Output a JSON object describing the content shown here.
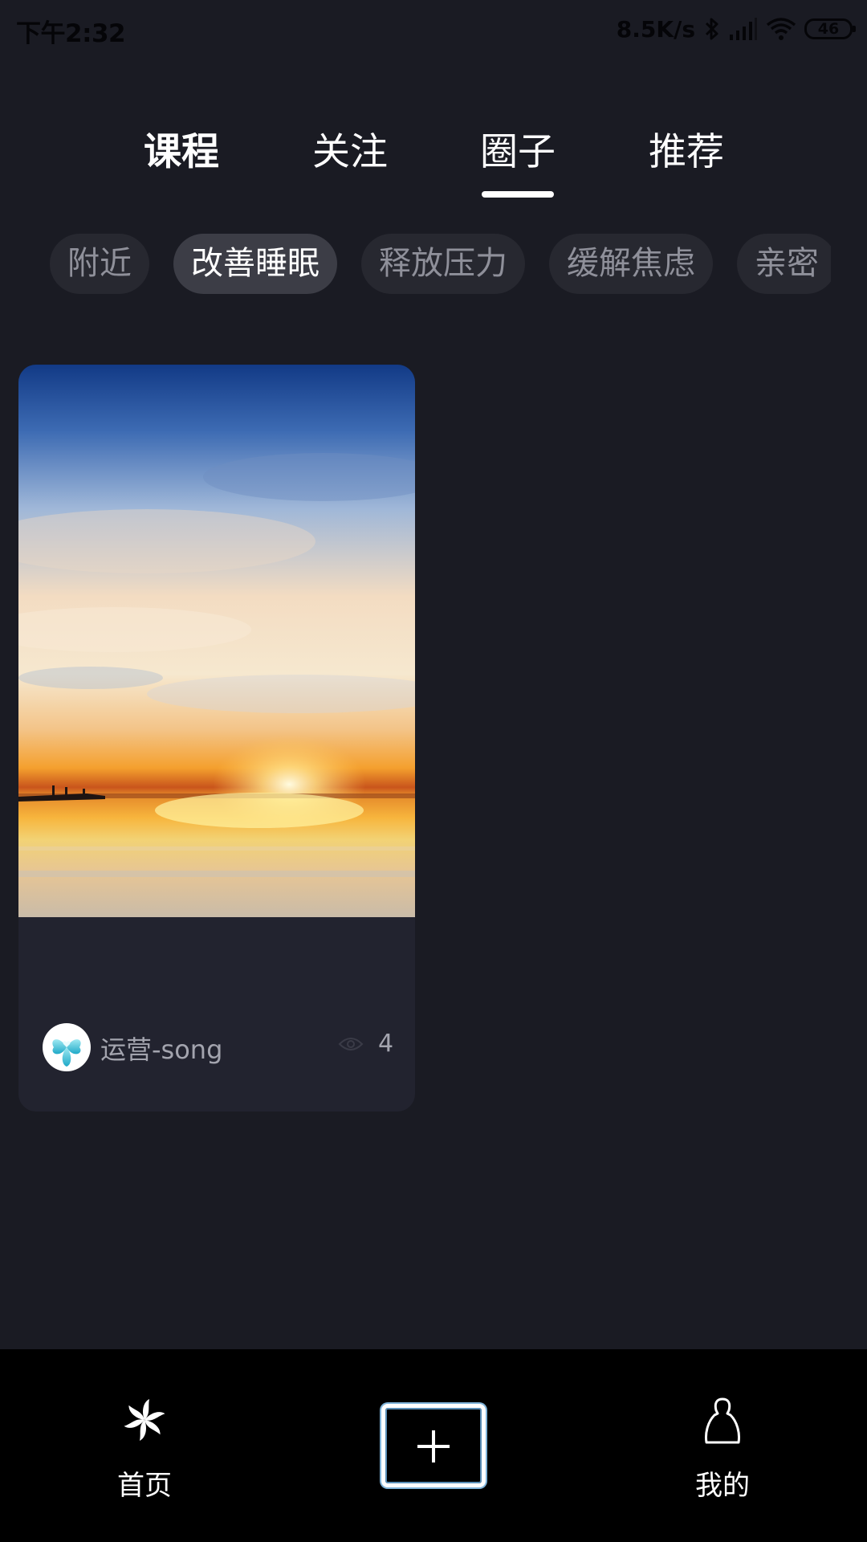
{
  "status_bar": {
    "time": "下午2:32",
    "net_speed": "8.5K/s",
    "battery": "46",
    "icons": [
      "bluetooth-icon",
      "signal-icon",
      "wifi-icon",
      "battery-icon"
    ]
  },
  "top_tabs": [
    {
      "label": "课程",
      "bold": true,
      "active": false
    },
    {
      "label": "关注",
      "bold": false,
      "active": false
    },
    {
      "label": "圈子",
      "bold": false,
      "active": true
    },
    {
      "label": "推荐",
      "bold": false,
      "active": false
    }
  ],
  "chips": [
    {
      "label": "附近",
      "active": false
    },
    {
      "label": "改善睡眠",
      "active": true
    },
    {
      "label": "释放压力",
      "active": false
    },
    {
      "label": "缓解焦虑",
      "active": false
    },
    {
      "label": "亲密",
      "active": false
    }
  ],
  "post": {
    "image": "sunset-over-lake",
    "author": "运营-song",
    "avatar": "clover-heart-avatar",
    "views": "4"
  },
  "bottom_nav": {
    "home_label": "首页",
    "home_icon": "pinwheel-icon",
    "add_icon": "plus-icon",
    "mine_label": "我的",
    "mine_icon": "person-icon"
  },
  "colors": {
    "background": "#1a1b23",
    "card": "#22232f",
    "chip": "#272830",
    "chip_active": "#3c3d46",
    "nav_bar": "#000000"
  }
}
